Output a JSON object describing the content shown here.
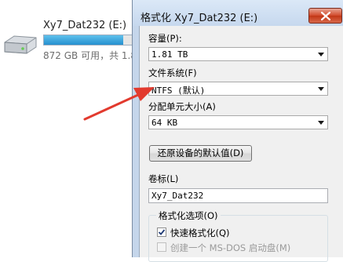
{
  "explorer": {
    "drive_title": "Xy7_Dat232 (E:)",
    "drive_free_text": "872 GB 可用，共 1.8",
    "drive_usage_fraction": 0.85
  },
  "dialog": {
    "title": "格式化 Xy7_Dat232 (E:)",
    "capacity_label": "容量(P):",
    "capacity_value": "1.81 TB",
    "filesystem_label": "文件系统(F)",
    "filesystem_value": "NTFS (默认)",
    "allocation_label": "分配单元大小(A)",
    "allocation_value": "64 KB",
    "restore_defaults_label": "还原设备的默认值(D)",
    "volume_label_title": "卷标(L)",
    "volume_label_value": "Xy7_Dat232",
    "format_options_title": "格式化选项(O)",
    "quick_format_label": "快速格式化(Q)",
    "quick_format_checked": true,
    "msdos_label": "创建一个 MS-DOS 启动盘(M)",
    "msdos_checked": false
  },
  "colors": {
    "annotation_arrow": "#e23a2e",
    "close_button": "#c9452a",
    "dialog_frame": "#c5d6eb"
  }
}
